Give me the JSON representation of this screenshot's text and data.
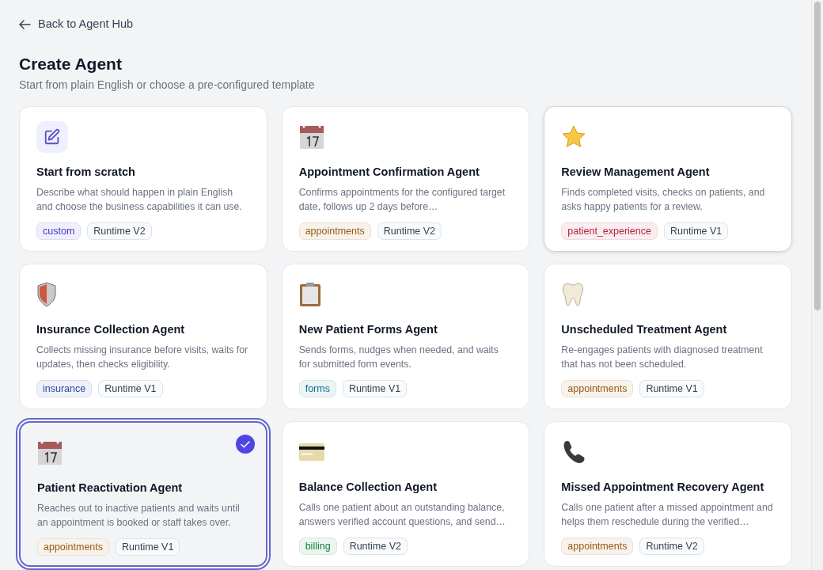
{
  "back_link": {
    "label": "Back to Agent Hub"
  },
  "header": {
    "title": "Create Agent",
    "subtitle": "Start from plain English or choose a pre-configured template"
  },
  "templates": [
    {
      "kind": "pencil",
      "name": "Start from scratch",
      "description": "Describe what should happen in plain English and choose the business capabilities it can use.",
      "tags": [
        {
          "label": "custom",
          "color": "#4338ca"
        },
        {
          "label": "Runtime V2",
          "color": "#374151"
        }
      ],
      "selected": false,
      "hovered": false
    },
    {
      "kind": "calendar",
      "name": "Appointment Confirmation Agent",
      "description": "Confirms appointments for the configured target date, follows up 2 days before…",
      "tags": [
        {
          "label": "appointments",
          "color": "#9a5b13"
        },
        {
          "label": "Runtime V2",
          "color": "#374151"
        }
      ],
      "selected": false,
      "hovered": false
    },
    {
      "kind": "star",
      "name": "Review Management Agent",
      "description": "Finds completed visits, checks on patients, and asks happy patients for a review.",
      "tags": [
        {
          "label": "patient_experience",
          "color": "#b4233c"
        },
        {
          "label": "Runtime V1",
          "color": "#374151"
        }
      ],
      "selected": false,
      "hovered": true
    },
    {
      "kind": "shield",
      "name": "Insurance Collection Agent",
      "description": "Collects missing insurance before visits, waits for updates, then checks eligibility.",
      "tags": [
        {
          "label": "insurance",
          "color": "#2c4aa8"
        },
        {
          "label": "Runtime V1",
          "color": "#374151"
        }
      ],
      "selected": false,
      "hovered": false
    },
    {
      "kind": "clipboard",
      "name": "New Patient Forms Agent",
      "description": "Sends forms, nudges when needed, and waits for submitted form events.",
      "tags": [
        {
          "label": "forms",
          "color": "#0e7490"
        },
        {
          "label": "Runtime V1",
          "color": "#374151"
        }
      ],
      "selected": false,
      "hovered": false
    },
    {
      "kind": "tooth",
      "name": "Unscheduled Treatment Agent",
      "description": "Re-engages patients with diagnosed treatment that has not been scheduled.",
      "tags": [
        {
          "label": "appointments",
          "color": "#9a5b13"
        },
        {
          "label": "Runtime V1",
          "color": "#374151"
        }
      ],
      "selected": false,
      "hovered": false
    },
    {
      "kind": "calendar",
      "name": "Patient Reactivation Agent",
      "description": "Reaches out to inactive patients and waits until an appointment is booked or staff takes over.",
      "tags": [
        {
          "label": "appointments",
          "color": "#9a5b13"
        },
        {
          "label": "Runtime V1",
          "color": "#374151"
        }
      ],
      "selected": true,
      "hovered": false
    },
    {
      "kind": "card",
      "name": "Balance Collection Agent",
      "description": "Calls one patient about an outstanding balance, answers verified account questions, and send…",
      "tags": [
        {
          "label": "billing",
          "color": "#15803d"
        },
        {
          "label": "Runtime V2",
          "color": "#374151"
        }
      ],
      "selected": false,
      "hovered": false
    },
    {
      "kind": "phone",
      "name": "Missed Appointment Recovery Agent",
      "description": "Calls one patient after a missed appointment and helps them reschedule during the verified…",
      "tags": [
        {
          "label": "appointments",
          "color": "#9a5b13"
        },
        {
          "label": "Runtime V2",
          "color": "#374151"
        }
      ],
      "selected": false,
      "hovered": false
    }
  ]
}
